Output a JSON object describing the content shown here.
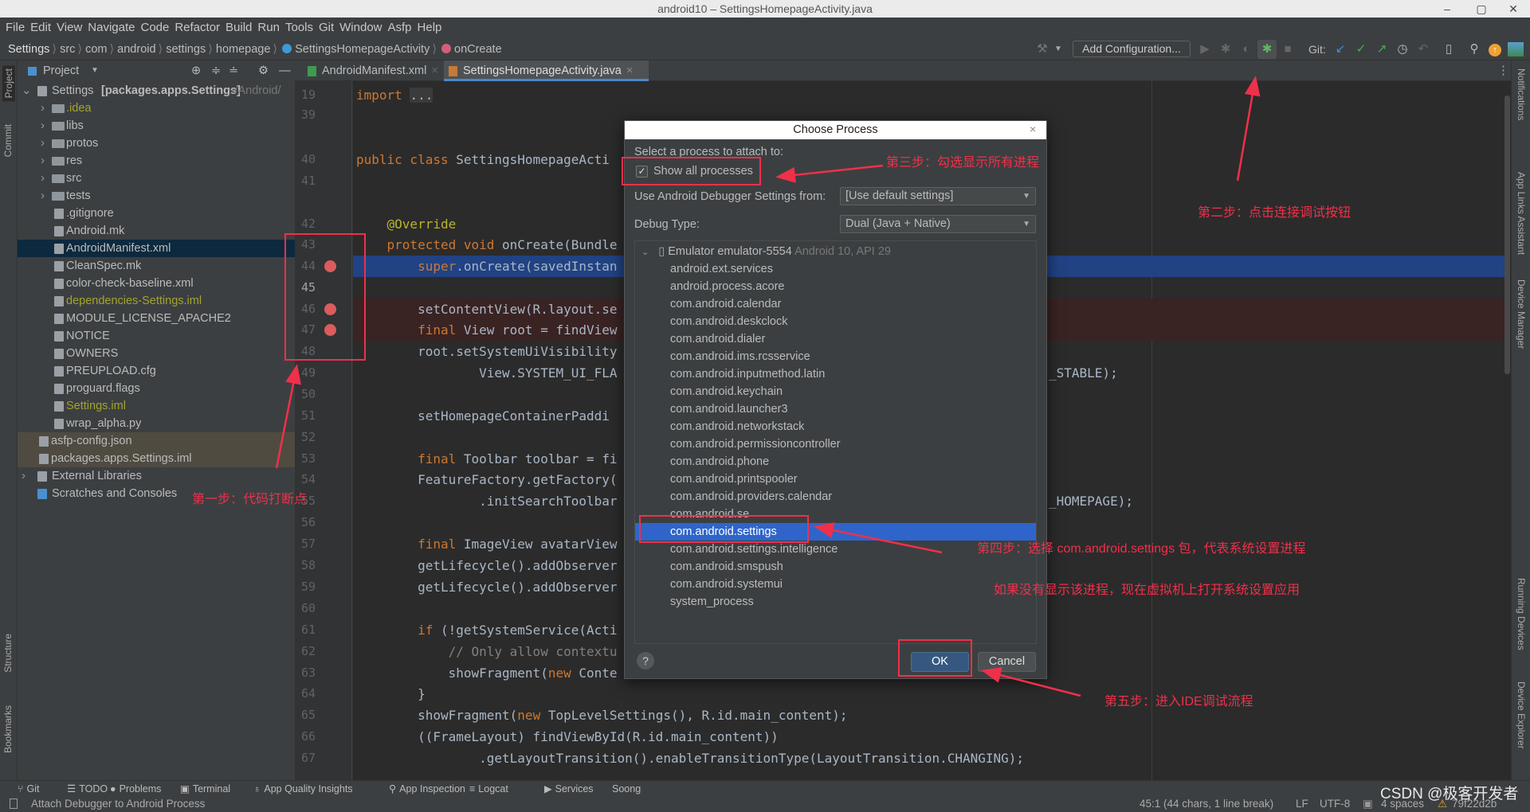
{
  "window": {
    "title": "android10 – SettingsHomepageActivity.java",
    "minimize": "–",
    "maximize": "▢",
    "close": "✕"
  },
  "menu": [
    "File",
    "Edit",
    "View",
    "Navigate",
    "Code",
    "Refactor",
    "Build",
    "Run",
    "Tools",
    "Git",
    "Window",
    "Asfp",
    "Help"
  ],
  "breadcrumb": [
    "Settings",
    "src",
    "com",
    "android",
    "settings",
    "homepage",
    "SettingsHomepageActivity",
    "onCreate"
  ],
  "toolbar": {
    "add_configuration": "Add Configuration...",
    "git_label": "Git:"
  },
  "project_panel": {
    "title": "Project",
    "tree": [
      {
        "label": "Settings",
        "bold": "[packages.apps.Settings]",
        "hint": "~/Android/",
        "level": 0,
        "type": "module",
        "expanded": true
      },
      {
        "label": ".idea",
        "level": 1,
        "type": "folder",
        "color": "#a3a32b"
      },
      {
        "label": "libs",
        "level": 1,
        "type": "folder"
      },
      {
        "label": "protos",
        "level": 1,
        "type": "folder"
      },
      {
        "label": "res",
        "level": 1,
        "type": "folder"
      },
      {
        "label": "src",
        "level": 1,
        "type": "folder"
      },
      {
        "label": "tests",
        "level": 1,
        "type": "folder"
      },
      {
        "label": ".gitignore",
        "level": 1,
        "type": "file"
      },
      {
        "label": "Android.mk",
        "level": 1,
        "type": "file"
      },
      {
        "label": "AndroidManifest.xml",
        "level": 1,
        "type": "file",
        "selected": true
      },
      {
        "label": "CleanSpec.mk",
        "level": 1,
        "type": "file"
      },
      {
        "label": "color-check-baseline.xml",
        "level": 1,
        "type": "file"
      },
      {
        "label": "dependencies-Settings.iml",
        "level": 1,
        "type": "file",
        "color": "#a3a32b"
      },
      {
        "label": "MODULE_LICENSE_APACHE2",
        "level": 1,
        "type": "file"
      },
      {
        "label": "NOTICE",
        "level": 1,
        "type": "file"
      },
      {
        "label": "OWNERS",
        "level": 1,
        "type": "file"
      },
      {
        "label": "PREUPLOAD.cfg",
        "level": 1,
        "type": "file"
      },
      {
        "label": "proguard.flags",
        "level": 1,
        "type": "file"
      },
      {
        "label": "Settings.iml",
        "level": 1,
        "type": "file",
        "color": "#a3a32b"
      },
      {
        "label": "wrap_alpha.py",
        "level": 1,
        "type": "file"
      },
      {
        "label": "asfp-config.json",
        "level": 0,
        "type": "file",
        "ignored": true
      },
      {
        "label": "packages.apps.Settings.iml",
        "level": 0,
        "type": "file",
        "ignored": true
      },
      {
        "label": "External Libraries",
        "level": 0,
        "type": "libs",
        "collapsed": true
      },
      {
        "label": "Scratches and Consoles",
        "level": 0,
        "type": "scratch"
      }
    ]
  },
  "editor": {
    "tabs": [
      {
        "label": "AndroidManifest.xml",
        "active": false
      },
      {
        "label": "SettingsHomepageActivity.java",
        "active": true
      }
    ],
    "current_line": 44,
    "breakpoints": [
      44,
      46,
      47
    ],
    "lines": [
      {
        "n": "19",
        "t": [
          [
            "kw",
            "import "
          ],
          [
            "fd",
            "..."
          ]
        ]
      },
      {
        "n": "39",
        "t": []
      },
      {
        "n": "40",
        "t": [
          [
            "kw",
            "public class "
          ],
          [
            "",
            "SettingsHomepageActi"
          ]
        ]
      },
      {
        "n": "41",
        "t": []
      },
      {
        "n": "42",
        "t": [
          [
            "ann",
            "    @Override"
          ]
        ]
      },
      {
        "n": "43",
        "t": [
          [
            "kw",
            "    protected void "
          ],
          [
            "",
            "onCreate(Bundle"
          ]
        ]
      },
      {
        "n": "44",
        "t": [
          [
            "kw",
            "        super"
          ],
          [
            "",
            ".onCreate(savedInstan"
          ]
        ]
      },
      {
        "n": "45",
        "t": []
      },
      {
        "n": "46",
        "t": [
          [
            "",
            "        setContentView(R.layout.se"
          ]
        ]
      },
      {
        "n": "47",
        "t": [
          [
            "kw",
            "        final "
          ],
          [
            "",
            "View root = findView"
          ]
        ]
      },
      {
        "n": "48",
        "t": [
          [
            "",
            "        root.setSystemUiVisibility"
          ]
        ]
      },
      {
        "n": "49",
        "t": [
          [
            "",
            "                View.SYSTEM_UI_FLA"
          ]
        ],
        "tail": "_STABLE);"
      },
      {
        "n": "50",
        "t": []
      },
      {
        "n": "51",
        "t": [
          [
            "",
            "        setHomepageContainerPaddi"
          ]
        ]
      },
      {
        "n": "52",
        "t": []
      },
      {
        "n": "53",
        "t": [
          [
            "kw",
            "        final "
          ],
          [
            "",
            "Toolbar toolbar = fi"
          ]
        ]
      },
      {
        "n": "54",
        "t": [
          [
            "",
            "        FeatureFactory.getFactory("
          ]
        ]
      },
      {
        "n": "55",
        "t": [
          [
            "",
            "                .initSearchToolbar"
          ]
        ],
        "tail": "_HOMEPAGE);"
      },
      {
        "n": "56",
        "t": []
      },
      {
        "n": "57",
        "t": [
          [
            "kw",
            "        final "
          ],
          [
            "",
            "ImageView avatarView"
          ]
        ]
      },
      {
        "n": "58",
        "t": [
          [
            "",
            "        getLifecycle().addObserver"
          ]
        ]
      },
      {
        "n": "59",
        "t": [
          [
            "",
            "        getLifecycle().addObserver"
          ]
        ]
      },
      {
        "n": "60",
        "t": []
      },
      {
        "n": "61",
        "t": [
          [
            "kw",
            "        if "
          ],
          [
            "",
            "(!getSystemService(Acti"
          ]
        ]
      },
      {
        "n": "62",
        "t": [
          [
            "cm",
            "            // Only allow contextu"
          ]
        ]
      },
      {
        "n": "63",
        "t": [
          [
            "",
            "            showFragment("
          ],
          [
            "kw",
            "new "
          ],
          [
            "",
            "Conte"
          ]
        ]
      },
      {
        "n": "64",
        "t": [
          [
            "",
            "        }"
          ]
        ]
      },
      {
        "n": "65",
        "t": [
          [
            "",
            "        showFragment("
          ],
          [
            "kw",
            "new "
          ],
          [
            "",
            "TopLevelSettings(), R.id.main_content);"
          ]
        ]
      },
      {
        "n": "66",
        "t": [
          [
            "",
            "        ((FrameLayout) findViewById(R.id.main_content))"
          ]
        ]
      },
      {
        "n": "67",
        "t": [
          [
            "",
            "                .getLayoutTransition().enableTransitionType(LayoutTransition.CHANGING);"
          ]
        ]
      }
    ]
  },
  "dialog": {
    "title": "Choose Process",
    "close": "×",
    "prompt": "Select a process to attach to:",
    "show_all_processes": {
      "label": "Show all processes",
      "checked": true
    },
    "debugger_settings_label": "Use Android Debugger Settings from:",
    "debugger_settings_value": "[Use default settings]",
    "debug_type_label": "Debug Type:",
    "debug_type_value": "Dual (Java + Native)",
    "device": {
      "name": "Emulator emulator-5554",
      "detail": "Android 10, API 29"
    },
    "processes": [
      "android.ext.services",
      "android.process.acore",
      "com.android.calendar",
      "com.android.deskclock",
      "com.android.dialer",
      "com.android.ims.rcsservice",
      "com.android.inputmethod.latin",
      "com.android.keychain",
      "com.android.launcher3",
      "com.android.networkstack",
      "com.android.permissioncontroller",
      "com.android.phone",
      "com.android.printspooler",
      "com.android.providers.calendar",
      "com.android.se",
      "com.android.settings",
      "com.android.settings.intelligence",
      "com.android.smspush",
      "com.android.systemui",
      "system_process"
    ],
    "selected_process": "com.android.settings",
    "help": "?",
    "ok": "OK",
    "cancel": "Cancel"
  },
  "annotations": {
    "step1": "第一步：代码打断点",
    "step2": "第二步：点击连接调试按钮",
    "step3": "第三步：勾选显示所有进程",
    "step4": "第四步：选择 com.android.settings 包，代表系统设置进程",
    "step4_note": "如果没有显示该进程，现在虚拟机上打开系统设置应用",
    "step5": "第五步：进入IDE调试流程",
    "color": "#f0304a"
  },
  "left_strip": [
    "Project",
    "Commit",
    "Structure",
    "Bookmarks"
  ],
  "right_strip": [
    "Notifications",
    "App Links Assistant",
    "Device Manager",
    "Running Devices",
    "Device Explorer"
  ],
  "bottom_tools": [
    "Git",
    "TODO",
    "Problems",
    "Terminal",
    "App Quality Insights",
    "App Inspection",
    "Logcat",
    "Services",
    "Soong"
  ],
  "status": {
    "message": "Attach Debugger to Android Process",
    "position": "45:1 (44 chars, 1 line break)",
    "line_sep": "LF",
    "encoding": "UTF-8",
    "indent": "4 spaces",
    "branch": "79f22d2b",
    "watermark": "CSDN @极客开发者"
  }
}
